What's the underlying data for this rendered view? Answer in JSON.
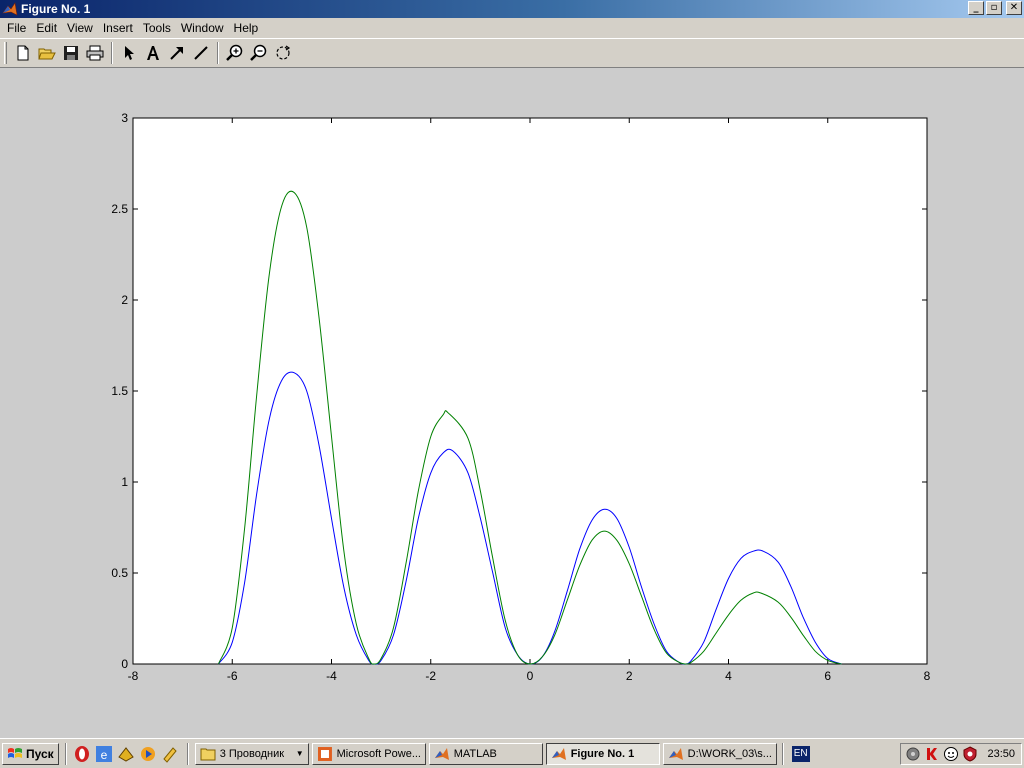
{
  "window": {
    "title": "Figure No. 1",
    "controls": {
      "minimize": "_",
      "maximize": "▫",
      "close": "✕"
    }
  },
  "menu": [
    "File",
    "Edit",
    "View",
    "Insert",
    "Tools",
    "Window",
    "Help"
  ],
  "toolbar": {
    "buttons": [
      "new-file-icon",
      "open-folder-icon",
      "save-icon",
      "print-icon",
      "select-arrow-icon",
      "insert-text-icon",
      "insert-arrow-icon",
      "insert-line-icon",
      "zoom-in-icon",
      "zoom-out-icon",
      "rotate-3d-icon"
    ]
  },
  "chart_data": {
    "type": "line",
    "title": "",
    "xlabel": "",
    "ylabel": "",
    "xlim": [
      -8,
      8
    ],
    "ylim": [
      0,
      3
    ],
    "xticks": [
      -8,
      -6,
      -4,
      -2,
      0,
      2,
      4,
      6,
      8
    ],
    "yticks": [
      0,
      0.5,
      1,
      1.5,
      2,
      2.5,
      3
    ],
    "xtick_labels": [
      "-8",
      "-6",
      "-4",
      "-2",
      "0",
      "2",
      "4",
      "6",
      "8"
    ],
    "ytick_labels": [
      "0",
      "0.5",
      "1",
      "1.5",
      "2",
      "2.5",
      "3"
    ],
    "grid": false,
    "series": [
      {
        "color": "#0000ff",
        "x": [
          -6.28,
          -6.0,
          -5.75,
          -5.5,
          -5.25,
          -5.0,
          -4.75,
          -4.5,
          -4.25,
          -4.0,
          -3.75,
          -3.5,
          -3.25,
          -3.14,
          -3.0,
          -2.75,
          -2.5,
          -2.25,
          -2.0,
          -1.75,
          -1.55,
          -1.25,
          -1.0,
          -0.75,
          -0.5,
          -0.25,
          0.0,
          0.25,
          0.5,
          0.75,
          1.0,
          1.25,
          1.5,
          1.75,
          2.0,
          2.25,
          2.5,
          2.75,
          3.0,
          3.14,
          3.25,
          3.5,
          3.75,
          4.0,
          4.25,
          4.5,
          4.7,
          5.0,
          5.25,
          5.5,
          5.75,
          6.0,
          6.28
        ],
        "y": [
          0.0,
          0.12,
          0.45,
          0.95,
          1.35,
          1.56,
          1.6,
          1.5,
          1.2,
          0.8,
          0.42,
          0.16,
          0.02,
          0.0,
          0.02,
          0.16,
          0.45,
          0.8,
          1.05,
          1.16,
          1.17,
          1.05,
          0.8,
          0.5,
          0.2,
          0.05,
          0.0,
          0.04,
          0.18,
          0.4,
          0.63,
          0.79,
          0.85,
          0.8,
          0.64,
          0.42,
          0.22,
          0.07,
          0.01,
          0.0,
          0.02,
          0.12,
          0.3,
          0.47,
          0.58,
          0.62,
          0.62,
          0.56,
          0.43,
          0.26,
          0.12,
          0.03,
          0.0
        ]
      },
      {
        "color": "#008000",
        "x": [
          -6.28,
          -6.0,
          -5.75,
          -5.5,
          -5.25,
          -5.0,
          -4.75,
          -4.5,
          -4.25,
          -4.0,
          -3.75,
          -3.5,
          -3.25,
          -3.14,
          -3.0,
          -2.75,
          -2.5,
          -2.25,
          -2.0,
          -1.75,
          -1.65,
          -1.25,
          -1.0,
          -0.75,
          -0.5,
          -0.25,
          0.0,
          0.25,
          0.5,
          0.75,
          1.0,
          1.25,
          1.5,
          1.75,
          2.0,
          2.25,
          2.5,
          2.75,
          3.0,
          3.14,
          3.25,
          3.5,
          3.75,
          4.0,
          4.25,
          4.5,
          4.65,
          5.0,
          5.25,
          5.5,
          5.75,
          6.0,
          6.28
        ],
        "y": [
          0.0,
          0.2,
          0.75,
          1.5,
          2.15,
          2.52,
          2.59,
          2.4,
          1.9,
          1.25,
          0.62,
          0.22,
          0.03,
          0.0,
          0.03,
          0.2,
          0.55,
          0.95,
          1.25,
          1.37,
          1.38,
          1.24,
          0.95,
          0.58,
          0.24,
          0.05,
          0.0,
          0.04,
          0.16,
          0.35,
          0.54,
          0.68,
          0.73,
          0.68,
          0.55,
          0.37,
          0.19,
          0.06,
          0.01,
          0.0,
          0.01,
          0.07,
          0.17,
          0.27,
          0.35,
          0.39,
          0.39,
          0.34,
          0.26,
          0.16,
          0.07,
          0.02,
          0.0
        ]
      }
    ]
  },
  "taskbar": {
    "start": "Пуск",
    "quick_launch": [
      "opera-icon",
      "ie-icon",
      "winamp-icon",
      "media-player-icon",
      "dictionary-icon"
    ],
    "tasks": [
      {
        "label": "3 Проводник",
        "icon": "folder-icon",
        "active": false
      },
      {
        "label": "Microsoft Powe...",
        "icon": "powerpoint-icon",
        "active": false
      },
      {
        "label": "MATLAB",
        "icon": "matlab-icon",
        "active": false
      },
      {
        "label": "Figure No. 1",
        "icon": "matlab-icon",
        "active": true
      },
      {
        "label": "D:\\WORK_03\\s...",
        "icon": "matlab-icon",
        "active": false
      }
    ],
    "language": "EN",
    "tray_icons": [
      "volume-icon",
      "kaspersky-icon",
      "network-icon",
      "shield-icon"
    ],
    "clock": "23:50"
  }
}
